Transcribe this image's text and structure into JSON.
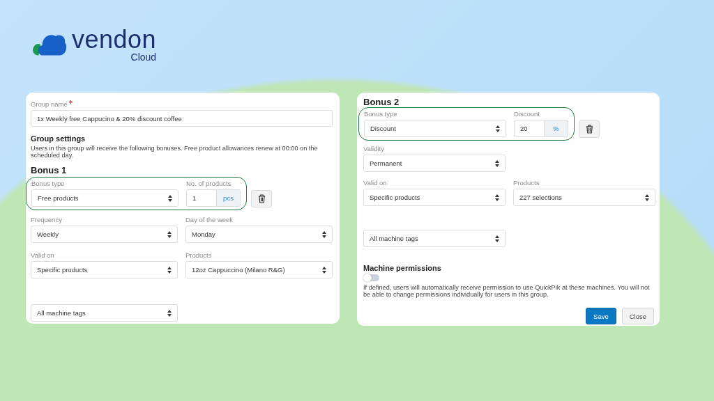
{
  "brand": {
    "name": "vendon",
    "sub": "Cloud"
  },
  "left_card": {
    "group_name": {
      "label": "Group name",
      "required": true,
      "value": "1x Weekly free Cappucino & 20% discount coffee"
    },
    "settings": {
      "title": "Group settings",
      "description": "Users in this group will receive the following bonuses. Free product allowances renew at 00:00 on the scheduled day."
    },
    "bonus": {
      "title": "Bonus 1",
      "highlighted": true,
      "type": {
        "label": "Bonus type",
        "value": "Free products"
      },
      "amount": {
        "label": "No. of products",
        "value": "1",
        "unit": "pcs"
      },
      "rows": [
        [
          {
            "label": "Frequency",
            "value": "Weekly"
          },
          {
            "label": "Day of the week",
            "value": "Monday"
          }
        ],
        [
          {
            "label": "Valid on",
            "value": "Specific products"
          },
          {
            "label": "Products",
            "value": "12oz Cappuccino (Milano R&G)"
          }
        ],
        [
          {
            "value": "All machine tags"
          }
        ]
      ]
    }
  },
  "right_card": {
    "bonus": {
      "title": "Bonus 2",
      "highlighted": true,
      "type": {
        "label": "Bonus type",
        "value": "Discount"
      },
      "amount": {
        "label": "Discount",
        "value": "20",
        "unit": "%"
      },
      "rows": [
        [
          {
            "label": "Validity",
            "value": "Permanent"
          }
        ],
        [
          {
            "label": "Valid on",
            "value": "Specific products"
          },
          {
            "label": "Products",
            "value": "227 selections"
          }
        ],
        [
          {
            "value": "All machine tags"
          }
        ]
      ]
    },
    "permissions": {
      "title": "Machine permissions",
      "on": false,
      "description": "If defined, users will automatically receive permission to use QuickPik at these machines. You will not be able to change permissions individually for users in this group."
    },
    "buttons": [
      {
        "label": "Save",
        "kind": "primary"
      },
      {
        "label": "Close",
        "kind": "secondary"
      }
    ]
  }
}
